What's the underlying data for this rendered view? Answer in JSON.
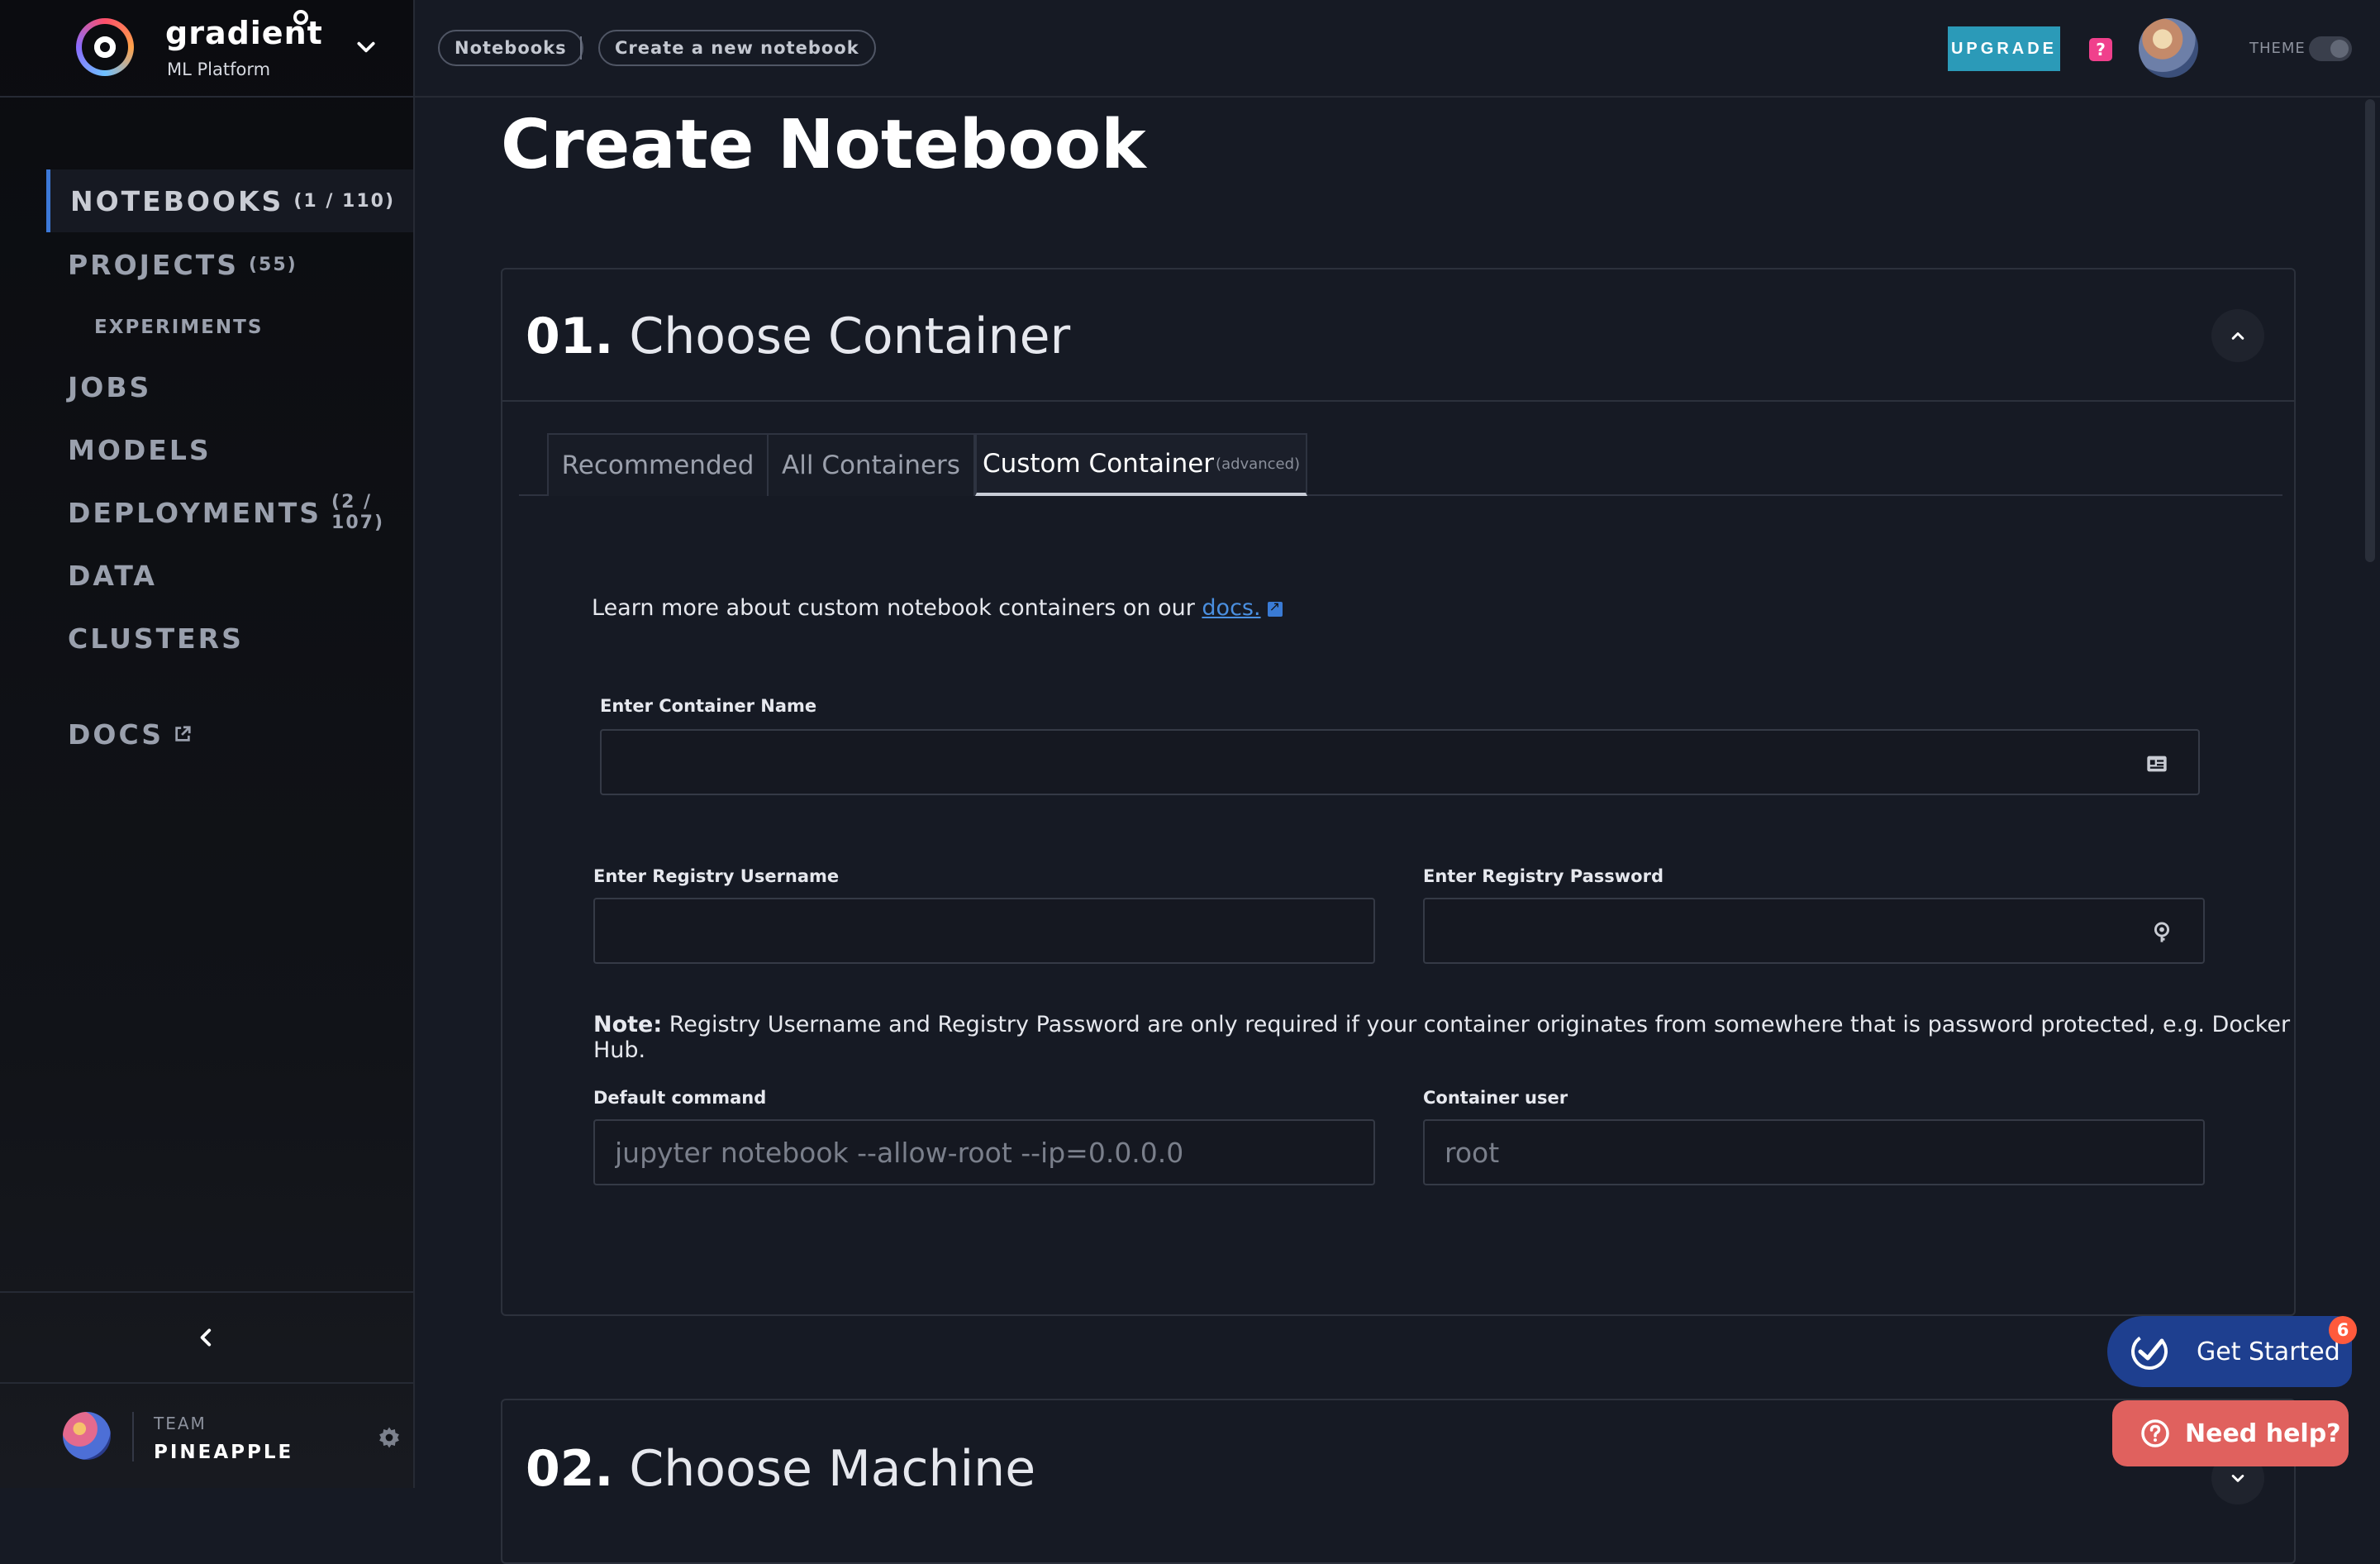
{
  "brand": {
    "name": "gradient",
    "subtitle": "ML Platform"
  },
  "breadcrumbs": [
    "Notebooks",
    "Create a new notebook"
  ],
  "topbar": {
    "upgrade_label": "UPGRADE",
    "help_label": "?",
    "theme_label": "THEME"
  },
  "sidebar": {
    "items": [
      {
        "label": "NOTEBOOKS",
        "count": "(1 / 110)"
      },
      {
        "label": "PROJECTS",
        "count": "(55)"
      },
      {
        "label": "EXPERIMENTS",
        "count": ""
      },
      {
        "label": "JOBS",
        "count": ""
      },
      {
        "label": "MODELS",
        "count": ""
      },
      {
        "label": "DEPLOYMENTS",
        "count": "(2 / 107)"
      },
      {
        "label": "DATA",
        "count": ""
      },
      {
        "label": "CLUSTERS",
        "count": ""
      },
      {
        "label": "DOCS",
        "count": ""
      }
    ],
    "team_label": "TEAM",
    "team_name": "PINEAPPLE"
  },
  "page_title": "Create Notebook",
  "section1": {
    "number": "01.",
    "title": "Choose Container",
    "tabs": [
      {
        "label": "Recommended",
        "suffix": ""
      },
      {
        "label": "All Containers",
        "suffix": ""
      },
      {
        "label": "Custom Container",
        "suffix": "(advanced)"
      }
    ],
    "learn_text": "Learn more about custom notebook containers on our ",
    "learn_link": "docs.",
    "container_name_label": "Enter Container Name",
    "container_name_value": "",
    "registry_username_label": "Enter Registry Username",
    "registry_username_value": "",
    "registry_password_label": "Enter Registry Password",
    "registry_password_value": "",
    "note_bold": "Note:",
    "note_text": " Registry Username and Registry Password are only required if your container originates from somewhere that is password protected, e.g. Docker Hub.",
    "default_command_label": "Default command",
    "default_command_placeholder": "jupyter notebook --allow-root --ip=0.0.0.0",
    "container_user_label": "Container user",
    "container_user_placeholder": "root"
  },
  "section2": {
    "number": "02.",
    "title": "Choose Machine"
  },
  "floating": {
    "get_started_label": "Get Started",
    "get_started_badge": "6",
    "need_help_label": "Need help?"
  },
  "colors": {
    "accent": "#3c78d8",
    "upgrade": "#2b9ab8",
    "help": "#f0408c",
    "get_started": "#1e3f8f",
    "need_help": "#e0615e",
    "link": "#4a8fe0"
  }
}
